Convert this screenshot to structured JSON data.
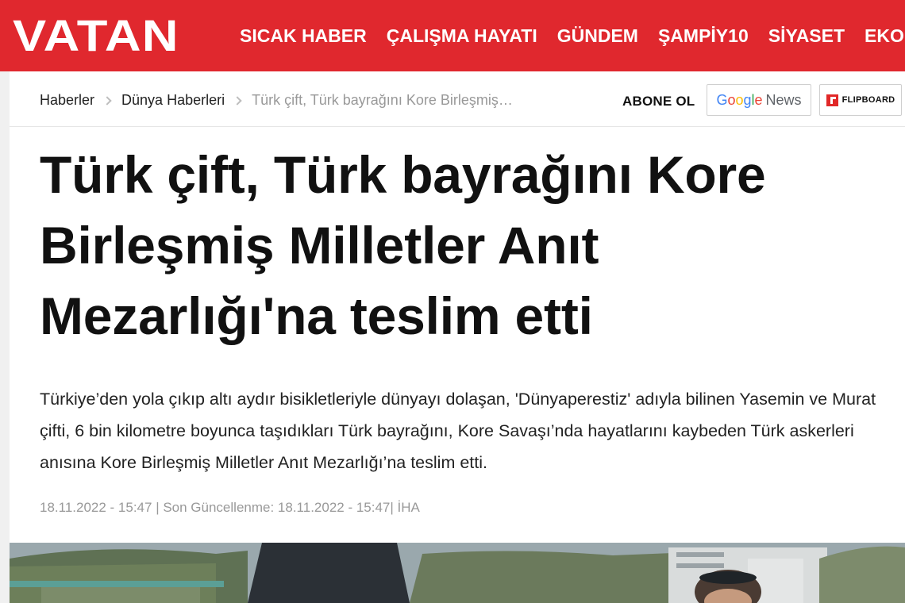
{
  "header": {
    "logo": "VATAN",
    "nav": [
      "SICAK HABER",
      "ÇALIŞMA HAYATI",
      "GÜNDEM",
      "ŞAMPİY10",
      "SİYASET",
      "EKO"
    ]
  },
  "breadcrumb": [
    "Haberler",
    "Dünya Haberleri",
    "Türk çift, Türk bayrağını Kore Birleşmiş…"
  ],
  "subscribe": {
    "label": "ABONE OL",
    "google": [
      "G",
      "o",
      "o",
      "g",
      "l",
      "e"
    ],
    "google_news": "News",
    "flipboard": "FLIPBOARD"
  },
  "article": {
    "title": "Türk çift, Türk bayrağını Kore Birleşmiş Milletler Anıt Mezarlığı'na teslim etti",
    "summary": "Türkiye’den yola çıkıp altı aydır bisikletleriyle dünyayı dolaşan, 'Dünyaperestiz' adıyla bilinen Yasemin ve Murat çifti, 6 bin kilometre boyunca taşıdıkları Türk bayrağını, Kore Savaşı’nda hayatlarını kaybeden Türk askerleri anısına Kore Birleşmiş Milletler Anıt Mezarlığı’na teslim etti.",
    "meta": "18.11.2022 - 15:47 | Son Güncellenme: 18.11.2022 - 15:47| İHA"
  },
  "colors": {
    "brand": "#e0282e",
    "flipboard": "#e12828"
  }
}
